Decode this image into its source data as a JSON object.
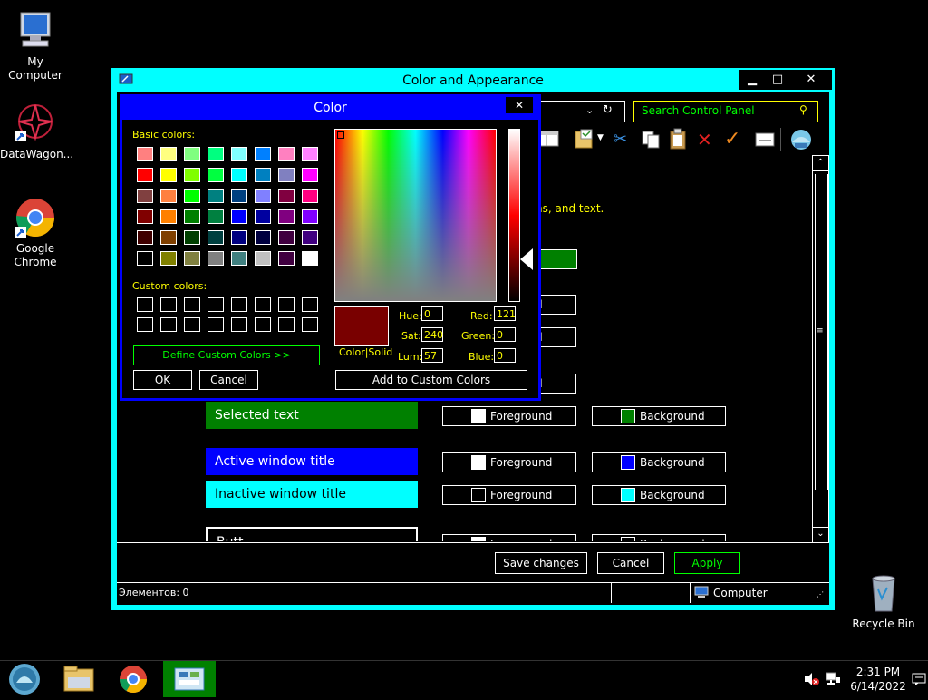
{
  "desktop": {
    "icons": [
      {
        "label": "My Computer"
      },
      {
        "label": "DataWagon..."
      },
      {
        "label": "Google Chrome"
      },
      {
        "label": "Recycle Bin"
      }
    ]
  },
  "main_window": {
    "title": "Color and Appearance",
    "search_placeholder": "Search Control Panel",
    "partial_text": "ns, and text.",
    "items": [
      {
        "label": "Selected text",
        "bg": "#008000",
        "fg_label": "Foreground",
        "bg_label": "Background",
        "fg_swatch": "#ffffff",
        "bg_swatch": "#008000"
      },
      {
        "label": "Active window title",
        "bg": "#0000ff",
        "fg_label": "Foreground",
        "bg_label": "Background",
        "fg_swatch": "#ffffff",
        "bg_swatch": "#0000ff"
      },
      {
        "label": "Inactive window title",
        "bg": "#00ffff",
        "fg_label": "Foreground",
        "bg_label": "Background",
        "fg_swatch": "#000000",
        "bg_swatch": "#00ffff"
      },
      {
        "label": "Butt",
        "bg": "#000000"
      }
    ],
    "partial_buttons": {
      "d1": "d",
      "d2": "d",
      "d3": "d",
      "fg": "Foreground",
      "bg": "Background"
    },
    "buttons": {
      "save": "Save changes",
      "cancel": "Cancel",
      "apply": "Apply"
    },
    "status": {
      "items": "Элементов: 0",
      "location": "Computer"
    }
  },
  "color_dialog": {
    "title": "Color",
    "basic_label": "Basic colors:",
    "custom_label": "Custom colors:",
    "define_custom": "Define Custom Colors >>",
    "ok": "OK",
    "cancel": "Cancel",
    "add_custom": "Add to Custom Colors",
    "color_solid": "Color|Solid",
    "current_color": "#790000",
    "fields": {
      "hue_label": "Hue:",
      "hue": "0",
      "sat_label": "Sat:",
      "sat": "240",
      "lum_label": "Lum:",
      "lum": "57",
      "red_label": "Red:",
      "red": "121",
      "green_label": "Green:",
      "green": "0",
      "blue_label": "Blue:",
      "blue": "0"
    },
    "basic_colors": [
      [
        "#ff8080",
        "#ffff80",
        "#80ff80",
        "#00ff80",
        "#80ffff",
        "#0080ff",
        "#ff80c0",
        "#ff80ff"
      ],
      [
        "#ff0000",
        "#ffff00",
        "#80ff00",
        "#00ff40",
        "#00ffff",
        "#0080c0",
        "#8080c0",
        "#ff00ff"
      ],
      [
        "#804040",
        "#ff8040",
        "#00ff00",
        "#008080",
        "#004080",
        "#8080ff",
        "#800040",
        "#ff0080"
      ],
      [
        "#800000",
        "#ff8000",
        "#008000",
        "#008040",
        "#0000ff",
        "#0000a0",
        "#800080",
        "#8000ff"
      ],
      [
        "#400000",
        "#804000",
        "#004000",
        "#004040",
        "#000080",
        "#000040",
        "#400040",
        "#400080"
      ],
      [
        "#000000",
        "#808000",
        "#808040",
        "#808080",
        "#408080",
        "#c0c0c0",
        "#400040",
        "#ffffff"
      ]
    ]
  },
  "taskbar": {
    "time": "2:31 PM",
    "date": "6/14/2022"
  }
}
